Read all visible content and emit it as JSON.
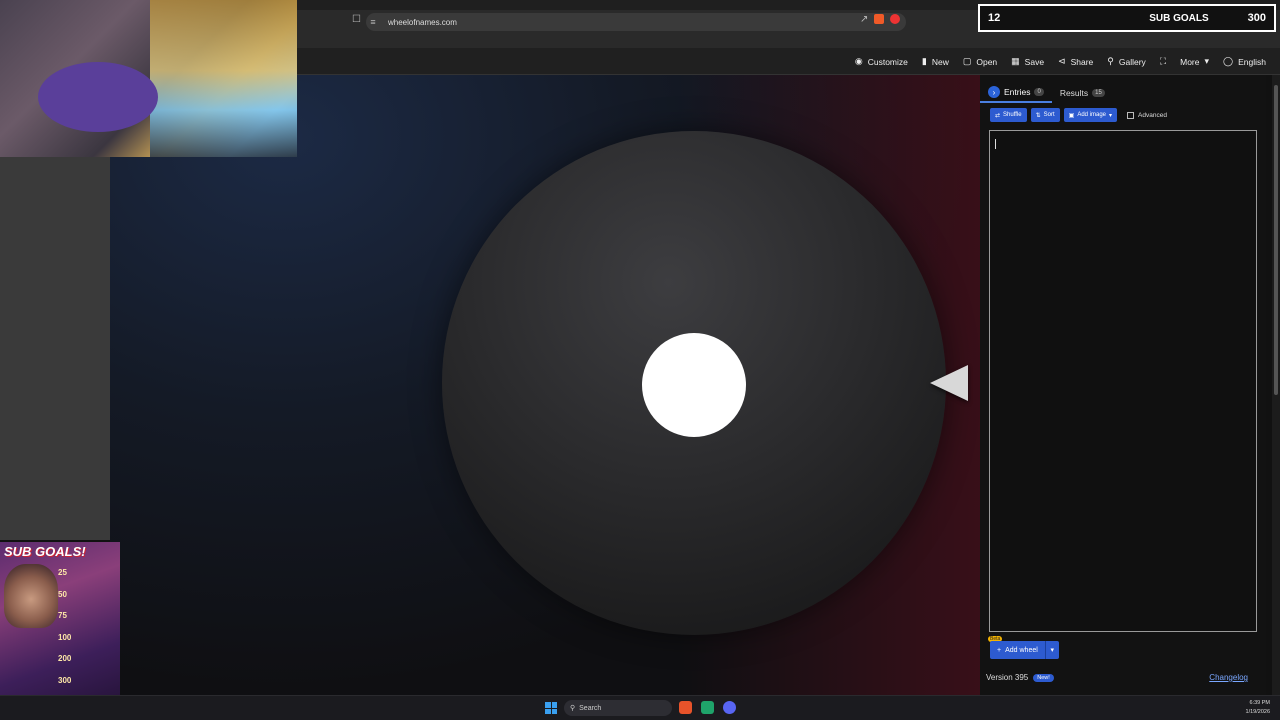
{
  "browser": {
    "url": "wheelofnames.com"
  },
  "toolbar": {
    "items": [
      {
        "icon": "palette-icon",
        "label": "Customize"
      },
      {
        "icon": "file-icon",
        "label": "New"
      },
      {
        "icon": "folder-open-icon",
        "label": "Open"
      },
      {
        "icon": "save-icon",
        "label": "Save"
      },
      {
        "icon": "share-icon",
        "label": "Share"
      },
      {
        "icon": "search-icon",
        "label": "Gallery"
      },
      {
        "icon": "fullscreen-icon",
        "label": ""
      },
      {
        "icon": "chevron-down-icon",
        "label": "More"
      },
      {
        "icon": "globe-icon",
        "label": "English"
      }
    ]
  },
  "panel": {
    "tabs": {
      "entries_label": "Entries",
      "entries_count": "0",
      "results_label": "Results",
      "results_count": "15"
    },
    "buttons": {
      "shuffle": "Shuffle",
      "sort": "Sort",
      "add_image": "Add image",
      "advanced": "Advanced"
    },
    "textarea_value": "",
    "add_wheel": {
      "beta": "Beta",
      "label": "Add wheel"
    },
    "version": "Version 395",
    "new_badge": "New!",
    "changelog": "Changelog"
  },
  "overlay": {
    "subgoal_count": "12",
    "subgoal_title": "SUB GOALS",
    "subgoal_target": "300",
    "poster_title": "SUB GOALS!",
    "poster_items": [
      "25",
      "50",
      "75",
      "100",
      "200",
      "300"
    ]
  },
  "taskbar": {
    "search": "Search",
    "time": "6:39 PM",
    "date": "1/19/2026"
  },
  "colors": {
    "accent": "#2d5bd0",
    "link": "#7aa7ff"
  }
}
